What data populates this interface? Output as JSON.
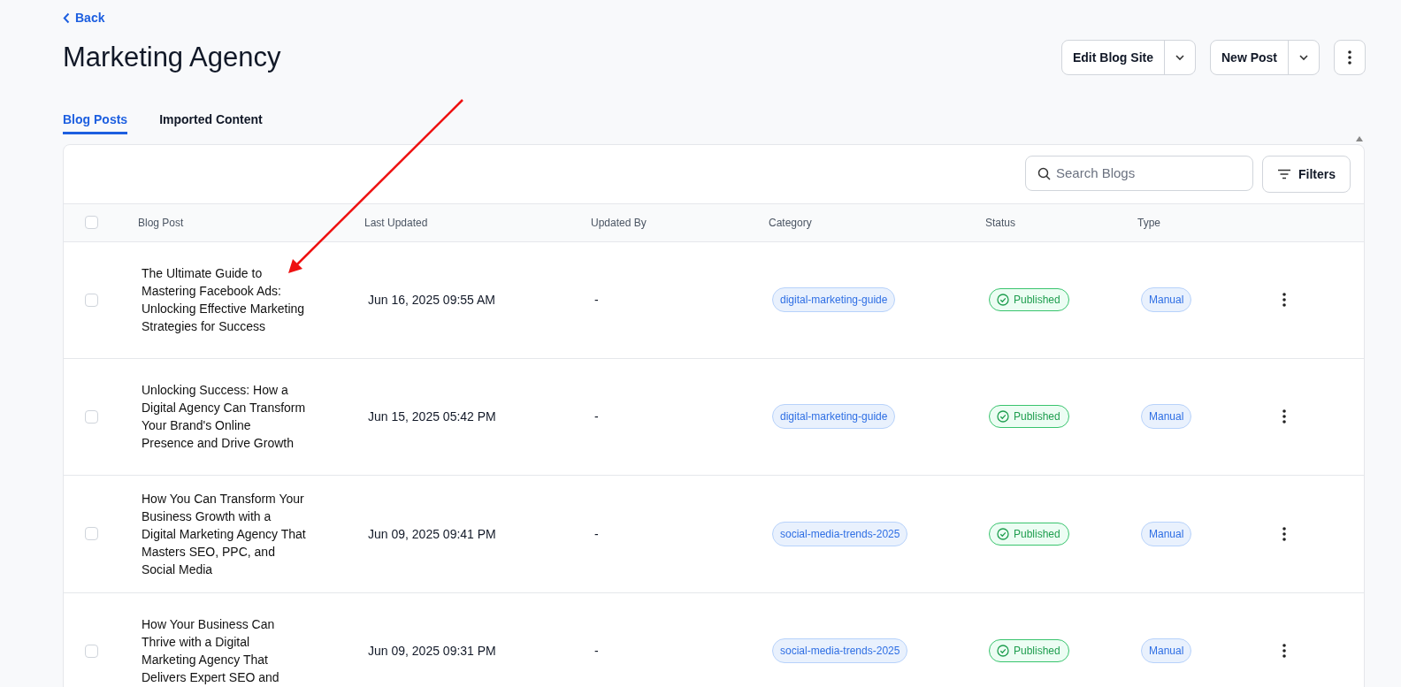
{
  "back_link": {
    "label": "Back"
  },
  "page_title": "Marketing Agency",
  "header_actions": [
    {
      "label": "Edit Blog Site",
      "kind": "split"
    },
    {
      "label": "New Post",
      "kind": "split"
    },
    {
      "kind": "more"
    }
  ],
  "tabs": [
    {
      "label": "Blog Posts",
      "selected": true
    },
    {
      "label": "Imported Content",
      "selected": false
    }
  ],
  "search": {
    "placeholder": "Search Blogs"
  },
  "filters_button": {
    "label": "Filters"
  },
  "table": {
    "select_all_checked": false,
    "columns": [
      "Blog Post",
      "Last Updated",
      "Updated By",
      "Category",
      "Status",
      "Type"
    ],
    "rows": [
      {
        "checked": false,
        "title": "The Ultimate Guide to Mastering Facebook Ads: Unlocking Effective Marketing Strategies for Success",
        "last_updated": "Jun 16, 2025 09:55 AM",
        "updated_by": "-",
        "category": "digital-marketing-guide",
        "status": "Published",
        "type": "Manual"
      },
      {
        "checked": false,
        "title": "Unlocking Success: How a Digital Agency Can Transform Your Brand's Online Presence and Drive Growth",
        "last_updated": "Jun 15, 2025 05:42 PM",
        "updated_by": "-",
        "category": "digital-marketing-guide",
        "status": "Published",
        "type": "Manual"
      },
      {
        "checked": false,
        "title": "How You Can Transform Your Business Growth with a Digital Marketing Agency That Masters SEO, PPC, and Social Media",
        "last_updated": "Jun 09, 2025 09:41 PM",
        "updated_by": "-",
        "category": "social-media-trends-2025",
        "status": "Published",
        "type": "Manual"
      },
      {
        "checked": false,
        "title": "How Your Business Can Thrive with a Digital Marketing Agency That Delivers Expert SEO and",
        "last_updated": "Jun 09, 2025 09:31 PM",
        "updated_by": "-",
        "category": "social-media-trends-2025",
        "status": "Published",
        "type": "Manual"
      }
    ]
  }
}
